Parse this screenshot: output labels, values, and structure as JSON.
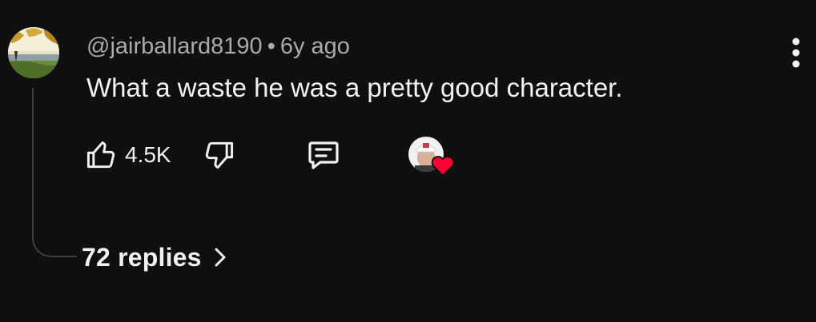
{
  "comment": {
    "author_handle": "@jairballard8190",
    "separator": "•",
    "timestamp": "6y ago",
    "text": "What a waste he was a pretty good character.",
    "like_count": "4.5K",
    "replies_label": "72 replies"
  },
  "icons": {
    "avatar": "landscape-avatar-icon",
    "menu": "more-vertical-icon",
    "like": "thumbs-up-icon",
    "dislike": "thumbs-down-icon",
    "reply": "comment-reply-icon",
    "creator_heart": "creator-heart-icon",
    "chevron": "chevron-right-icon"
  },
  "colors": {
    "background": "#0f0f0f",
    "primary_text": "#f1f1f1",
    "secondary_text": "#aaaaaa",
    "thread_line": "#3d3d3d",
    "heart": "#ff0033"
  }
}
